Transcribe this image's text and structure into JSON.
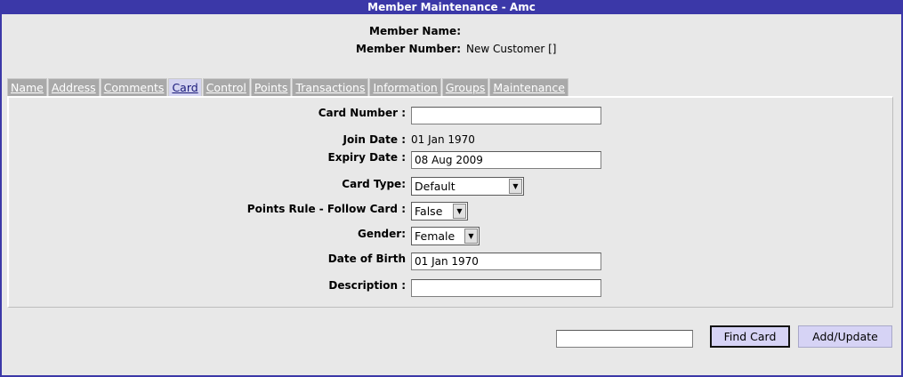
{
  "window": {
    "title": "Member Maintenance - Amc"
  },
  "header": {
    "member_name_label": "Member Name:",
    "member_name_value": "",
    "member_number_label": "Member Number:",
    "member_number_value": "New Customer []"
  },
  "tabs": [
    {
      "label": "Name"
    },
    {
      "label": "Address"
    },
    {
      "label": "Comments"
    },
    {
      "label": "Card",
      "active": true
    },
    {
      "label": "Control"
    },
    {
      "label": "Points"
    },
    {
      "label": "Transactions"
    },
    {
      "label": "Information"
    },
    {
      "label": "Groups"
    },
    {
      "label": "Maintenance"
    }
  ],
  "form": {
    "card_number": {
      "label": "Card Number :",
      "value": ""
    },
    "join_date": {
      "label": "Join Date :",
      "value": "01 Jan 1970"
    },
    "expiry_date": {
      "label": "Expiry Date :",
      "value": "08 Aug 2009"
    },
    "card_type": {
      "label": "Card Type:",
      "value": "Default"
    },
    "points_rule": {
      "label": "Points Rule - Follow Card :",
      "value": "False"
    },
    "gender": {
      "label": "Gender:",
      "value": "Female"
    },
    "dob": {
      "label": "Date of Birth",
      "value": "01 Jan 1970"
    },
    "description": {
      "label": "Description :",
      "value": ""
    }
  },
  "footer": {
    "find_input_value": "",
    "find_card_label": "Find Card",
    "add_update_label": "Add/Update"
  },
  "icons": {
    "dropdown": "chevron-down-icon"
  },
  "colors": {
    "title_bar": "#3b38a8",
    "active_tab": "#d3d3f0",
    "button": "#d6d3f5"
  }
}
